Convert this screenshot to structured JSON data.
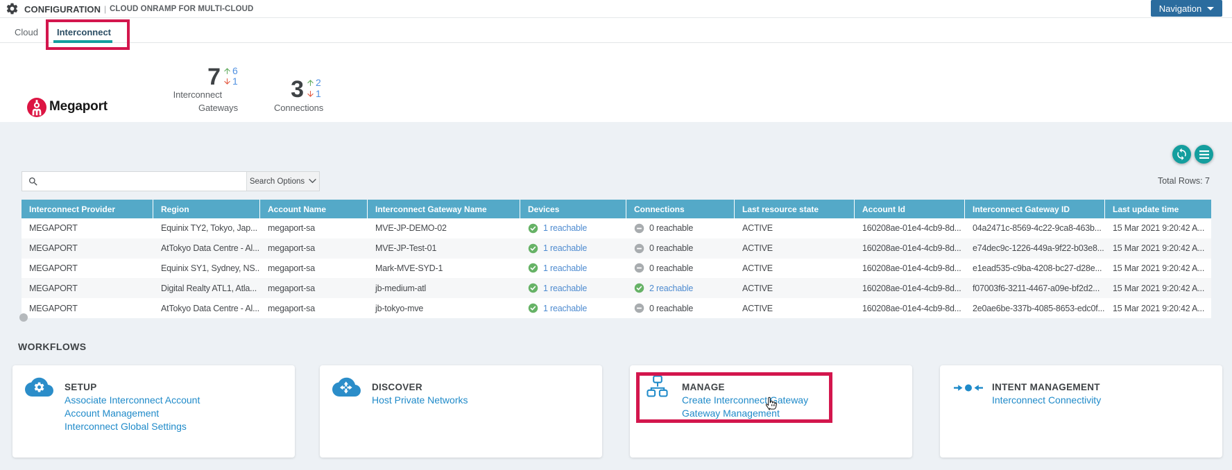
{
  "header": {
    "title": "CONFIGURATION",
    "separator": "|",
    "subtitle": "CLOUD ONRAMP FOR MULTI-CLOUD",
    "nav_button_label": "Navigation"
  },
  "tabs": [
    {
      "label": "Cloud",
      "active": false
    },
    {
      "label": "Interconnect",
      "active": true
    }
  ],
  "provider": {
    "name": "Megaport"
  },
  "stats": [
    {
      "value": "7",
      "up": "6",
      "down": "1",
      "label_lines": [
        "Interconnect",
        "Gateways"
      ]
    },
    {
      "value": "3",
      "up": "2",
      "down": "1",
      "label_lines": [
        "Connections"
      ]
    }
  ],
  "toolbar": {
    "search_value": "",
    "search_options_label": "Search Options",
    "total_rows_label": "Total Rows: 7"
  },
  "table": {
    "columns": [
      "Interconnect Provider",
      "Region",
      "Account Name",
      "Interconnect Gateway Name",
      "Devices",
      "Connections",
      "Last resource state",
      "Account Id",
      "Interconnect Gateway ID",
      "Last update time"
    ],
    "rows": [
      {
        "provider": "MEGAPORT",
        "region": "Equinix TY2, Tokyo, Jap...",
        "account_name": "megaport-sa",
        "gateway_name": "MVE-JP-DEMO-02",
        "devices": {
          "text": "1 reachable",
          "status": "ok"
        },
        "connections": {
          "text": "0 reachable",
          "status": "none"
        },
        "state": "ACTIVE",
        "account_id": "160208ae-01e4-4cb9-8d...",
        "gateway_id": "04a2471c-8569-4c22-9ca8-463b...",
        "updated": "15 Mar 2021 9:20:42 A..."
      },
      {
        "provider": "MEGAPORT",
        "region": "AtTokyo Data Centre - Al...",
        "account_name": "megaport-sa",
        "gateway_name": "MVE-JP-Test-01",
        "devices": {
          "text": "1 reachable",
          "status": "ok"
        },
        "connections": {
          "text": "0 reachable",
          "status": "none"
        },
        "state": "ACTIVE",
        "account_id": "160208ae-01e4-4cb9-8d...",
        "gateway_id": "e74dec9c-1226-449a-9f22-b03e8...",
        "updated": "15 Mar 2021 9:20:42 A..."
      },
      {
        "provider": "MEGAPORT",
        "region": "Equinix SY1, Sydney, NS...",
        "account_name": "megaport-sa",
        "gateway_name": "Mark-MVE-SYD-1",
        "devices": {
          "text": "1 reachable",
          "status": "ok"
        },
        "connections": {
          "text": "0 reachable",
          "status": "none"
        },
        "state": "ACTIVE",
        "account_id": "160208ae-01e4-4cb9-8d...",
        "gateway_id": "e1ead535-c9ba-4208-bc27-d28e...",
        "updated": "15 Mar 2021 9:20:42 A..."
      },
      {
        "provider": "MEGAPORT",
        "region": "Digital Realty ATL1, Atla...",
        "account_name": "megaport-sa",
        "gateway_name": "jb-medium-atl",
        "devices": {
          "text": "1 reachable",
          "status": "ok"
        },
        "connections": {
          "text": "2 reachable",
          "status": "ok"
        },
        "state": "ACTIVE",
        "account_id": "160208ae-01e4-4cb9-8d...",
        "gateway_id": "f07003f6-3211-4467-a09e-bf2d2...",
        "updated": "15 Mar 2021 9:20:42 A..."
      },
      {
        "provider": "MEGAPORT",
        "region": "AtTokyo Data Centre - Al...",
        "account_name": "megaport-sa",
        "gateway_name": "jb-tokyo-mve",
        "devices": {
          "text": "1 reachable",
          "status": "ok"
        },
        "connections": {
          "text": "0 reachable",
          "status": "none"
        },
        "state": "ACTIVE",
        "account_id": "160208ae-01e4-4cb9-8d...",
        "gateway_id": "2e0ae6be-337b-4085-8653-edc0f...",
        "updated": "15 Mar 2021 9:20:42 A..."
      }
    ]
  },
  "workflows": {
    "heading": "WORKFLOWS",
    "cards": [
      {
        "title": "SETUP",
        "icon": "cloud-gear-icon",
        "links": [
          "Associate Interconnect Account",
          "Account Management",
          "Interconnect Global Settings"
        ],
        "highlighted": false
      },
      {
        "title": "DISCOVER",
        "icon": "cloud-arrows-icon",
        "links": [
          "Host Private Networks"
        ],
        "highlighted": false
      },
      {
        "title": "MANAGE",
        "icon": "topology-icon",
        "links": [
          "Create Interconnect Gateway",
          "Gateway Management"
        ],
        "highlighted": true
      },
      {
        "title": "INTENT MANAGEMENT",
        "icon": "converge-arrows-icon",
        "links": [
          "Interconnect Connectivity"
        ],
        "highlighted": false
      }
    ]
  },
  "annotations": {
    "highlight_color": "#d3164d",
    "highlighted_tab": "Interconnect",
    "highlighted_card": "MANAGE"
  },
  "colors": {
    "table_header": "#54a9c8",
    "panel_background": "#edf1f5",
    "teal_button": "#149e9e",
    "navigation_button": "#2b6c9e",
    "tab_underline": "#149f9f",
    "workflow_link": "#1f8ac9",
    "reachable_link": "#4e8bd0",
    "status_ok_green": "#66b266",
    "status_none_gray": "#a8acaf",
    "megaport_red": "#dc1543",
    "stat_up_green": "#61aa5e",
    "stat_down_red": "#e2573f",
    "stat_count_blue": "#5191e1"
  }
}
